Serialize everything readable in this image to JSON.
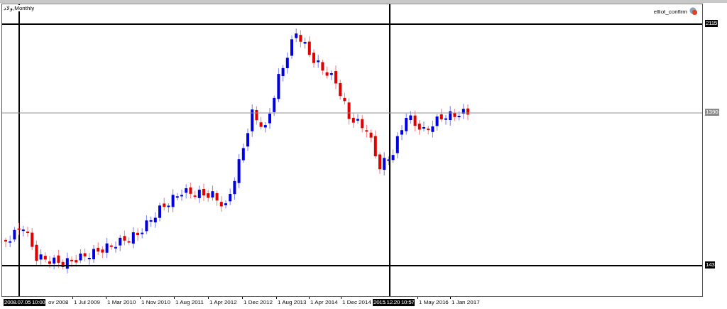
{
  "chart": {
    "title": "ولاد,Monthly",
    "indicator": "elliot_confirm",
    "price_labels": [
      {
        "text": "2115",
        "kind": "line"
      },
      {
        "text": "1390",
        "kind": "current"
      },
      {
        "text": "143",
        "kind": "line"
      }
    ],
    "time_labels": [
      {
        "text": "2008.07.05 10:00",
        "kind": "line"
      },
      {
        "text": "ov 2008",
        "kind": "tick"
      },
      {
        "text": "1 Jul 2009",
        "kind": "tick"
      },
      {
        "text": "1 Mar 2010",
        "kind": "tick"
      },
      {
        "text": "1 Nov 2010",
        "kind": "tick"
      },
      {
        "text": "1 Aug 2011",
        "kind": "tick"
      },
      {
        "text": "1 Apr 2012",
        "kind": "tick"
      },
      {
        "text": "1 Dec 2012",
        "kind": "tick"
      },
      {
        "text": "1 Aug 2013",
        "kind": "tick"
      },
      {
        "text": "1 Apr 2014",
        "kind": "tick"
      },
      {
        "text": "1 Dec 2014",
        "kind": "tick"
      },
      {
        "text": "2015.12.20 10:57",
        "kind": "line"
      },
      {
        "text": "1 May 2016",
        "kind": "tick"
      },
      {
        "text": "1 Jan 2017",
        "kind": "tick"
      }
    ]
  }
}
